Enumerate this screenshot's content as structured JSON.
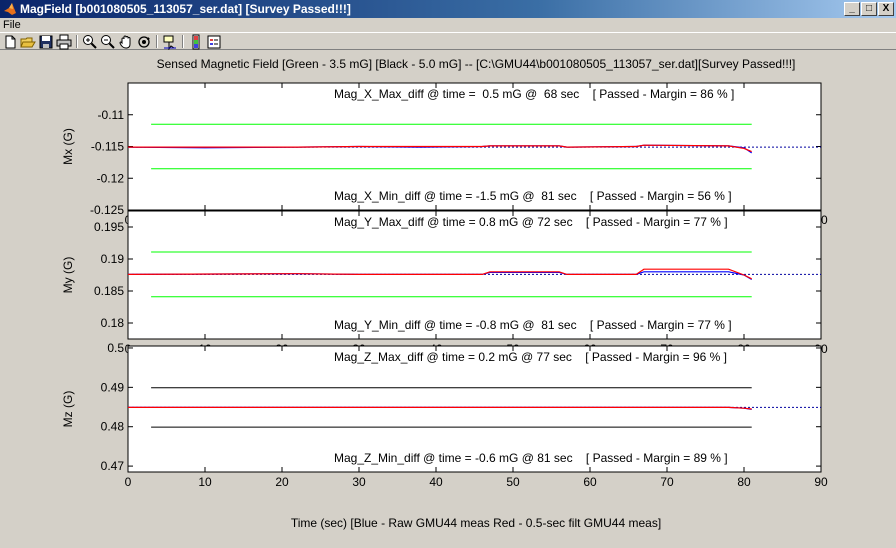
{
  "window": {
    "title": "MagField [b001080505_113057_ser.dat] [Survey Passed!!!]",
    "minimize_label": "_",
    "maximize_label": "□",
    "close_label": "X"
  },
  "menu": {
    "file_label": "File"
  },
  "toolbar": {
    "icons": [
      "new-file-icon",
      "open-folder-icon",
      "save-icon",
      "print-icon",
      "zoom-in-icon",
      "zoom-out-icon",
      "pan-hand-icon",
      "rotate-3d-icon",
      "data-cursor-icon",
      "insert-colorbar-icon",
      "insert-legend-icon"
    ]
  },
  "figure": {
    "title": "Sensed Magnetic Field [Green - 3.5 mG] [Black - 5.0 mG] -- [C:\\GMU44\\b001080505_113057_ser.dat][Survey Passed!!!]",
    "xlabel": "Time (sec) [Blue - Raw GMU44 meas   Red - 0.5-sec filt GMU44 meas]",
    "colors": {
      "raw": "#0000ff",
      "filtered": "#ff0000",
      "reference": "#0000a0",
      "green_limit": "#00ff00",
      "black_limit": "#000000"
    }
  },
  "chart_data": [
    {
      "type": "line",
      "ylabel": "Mx (G)",
      "xlim": [
        0,
        90
      ],
      "ylim": [
        -0.125,
        -0.105
      ],
      "xticks": [
        "0",
        "10",
        "20",
        "30",
        "40",
        "50",
        "60",
        "70",
        "80",
        "90"
      ],
      "yticks": [
        "-0.125",
        "-0.12",
        "-0.115",
        "-0.11"
      ],
      "limit_color": "green",
      "limits": [
        -0.1185,
        -0.1115
      ],
      "reference": -0.1151,
      "series": [
        {
          "name": "Blue - Raw GMU44 meas",
          "x": [
            0,
            10,
            22,
            30,
            38,
            46,
            47,
            56,
            57,
            66,
            67,
            78,
            80,
            81
          ],
          "y": [
            -0.1151,
            -0.1152,
            -0.1151,
            -0.115,
            -0.1151,
            -0.115,
            -0.1149,
            -0.1149,
            -0.1151,
            -0.115,
            -0.1148,
            -0.1149,
            -0.1152,
            -0.116
          ]
        },
        {
          "name": "Red - 0.5-sec filt GMU44 meas",
          "x": [
            0,
            22,
            30,
            46,
            47,
            56,
            57,
            66,
            67,
            78,
            80,
            81
          ],
          "y": [
            -0.1151,
            -0.1151,
            -0.115,
            -0.115,
            -0.1149,
            -0.1149,
            -0.1151,
            -0.115,
            -0.1148,
            -0.1149,
            -0.1153,
            -0.1158
          ]
        }
      ],
      "annotations": [
        "Mag_X_Max_diff @ time =  0.5 mG @  68 sec    [ Passed - Margin = 86 % ]",
        "Mag_X_Min_diff @ time = -1.5 mG @  81 sec    [ Passed - Margin = 56 % ]"
      ]
    },
    {
      "type": "line",
      "ylabel": "My (G)",
      "xlim": [
        0,
        90
      ],
      "ylim": [
        0.1775,
        0.1975
      ],
      "xticks": [
        "0",
        "10",
        "20",
        "30",
        "40",
        "50",
        "60",
        "70",
        "80",
        "90"
      ],
      "yticks": [
        "0.18",
        "0.185",
        "0.19",
        "0.195"
      ],
      "limit_color": "green",
      "limits": [
        0.1841,
        0.1911
      ],
      "reference": 0.1876,
      "series": [
        {
          "name": "Blue - Raw GMU44 meas",
          "x": [
            0,
            22,
            30,
            46,
            47,
            56,
            57,
            66,
            67,
            78,
            80,
            81
          ],
          "y": [
            0.1876,
            0.1877,
            0.1876,
            0.1876,
            0.1879,
            0.1879,
            0.1876,
            0.1876,
            0.188,
            0.188,
            0.1875,
            0.1868
          ]
        },
        {
          "name": "Red - 0.5-sec filt GMU44 meas",
          "x": [
            0,
            22,
            30,
            46,
            47,
            56,
            57,
            66,
            67,
            78,
            80,
            81
          ],
          "y": [
            0.1876,
            0.1877,
            0.1876,
            0.1876,
            0.188,
            0.188,
            0.1876,
            0.1876,
            0.1884,
            0.1884,
            0.1875,
            0.1869
          ]
        }
      ],
      "annotations": [
        "Mag_Y_Max_diff @ time = 0.8 mG @ 72 sec    [ Passed - Margin = 77 % ]",
        "Mag_Y_Min_diff @ time = -0.8 mG @  81 sec    [ Passed - Margin = 77 % ]"
      ]
    },
    {
      "type": "line",
      "ylabel": "Mz (G)",
      "xlim": [
        0,
        90
      ],
      "ylim": [
        0.4685,
        0.5005
      ],
      "xticks": [
        "0",
        "10",
        "20",
        "30",
        "40",
        "50",
        "60",
        "70",
        "80",
        "90"
      ],
      "yticks": [
        "0.47",
        "0.48",
        "0.49",
        "0.5"
      ],
      "limit_color": "black",
      "limits": [
        0.4799,
        0.4899
      ],
      "reference": 0.4849,
      "series": [
        {
          "name": "Blue - Raw GMU44 meas",
          "x": [
            0,
            20,
            40,
            60,
            78,
            80,
            81
          ],
          "y": [
            0.4849,
            0.4849,
            0.4849,
            0.4849,
            0.4849,
            0.4847,
            0.4844
          ]
        },
        {
          "name": "Red - 0.5-sec filt GMU44 meas",
          "x": [
            0,
            20,
            40,
            60,
            78,
            80,
            81
          ],
          "y": [
            0.4849,
            0.4849,
            0.4849,
            0.4849,
            0.4849,
            0.4847,
            0.4845
          ]
        }
      ],
      "annotations": [
        "Mag_Z_Max_diff @ time = 0.2 mG @ 77 sec    [ Passed - Margin = 96 % ]",
        "Mag_Z_Min_diff @ time = -0.6 mG @ 81 sec    [ Passed - Margin = 89 % ]"
      ]
    }
  ]
}
